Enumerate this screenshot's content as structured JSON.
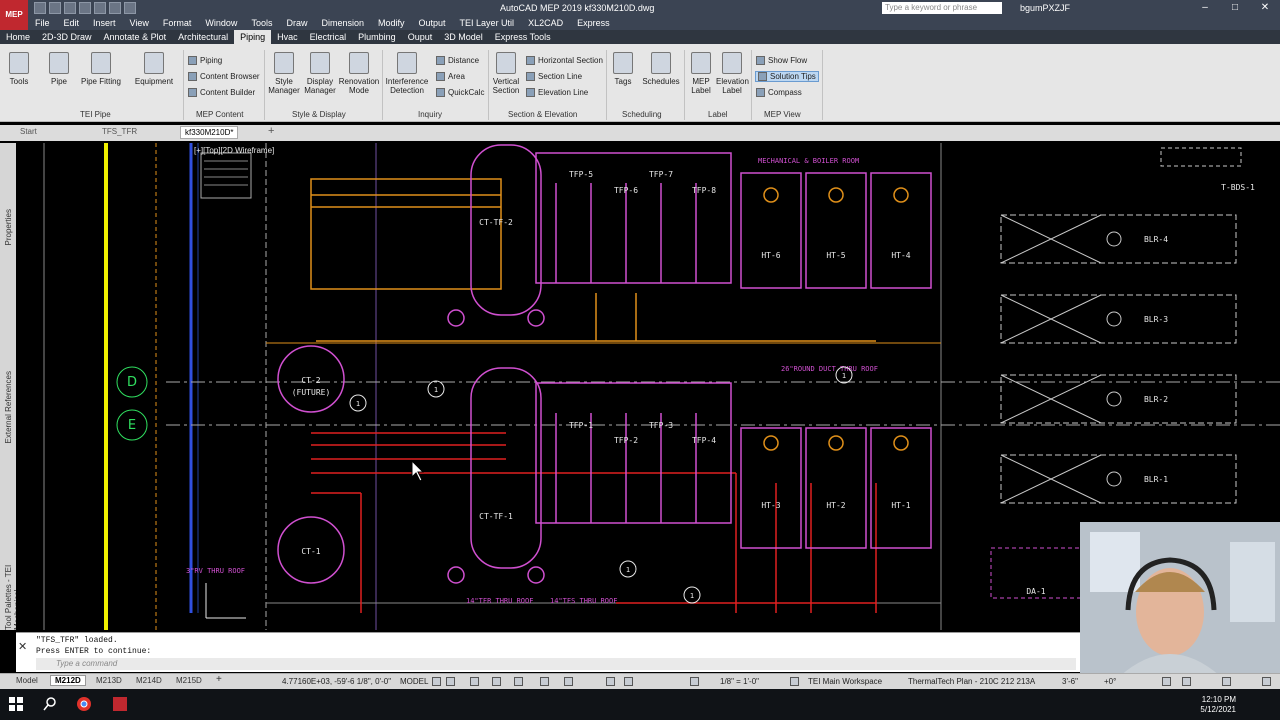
{
  "app": {
    "title": "AutoCAD MEP 2019    kf330M210D.dwg",
    "logo": "MEP",
    "search_placeholder": "Type a keyword or phrase",
    "user": "bgumPXZJF"
  },
  "menu": [
    "File",
    "Edit",
    "Insert",
    "View",
    "Format",
    "Window",
    "Tools",
    "Draw",
    "Dimension",
    "Modify",
    "Output",
    "TEI Layer Util",
    "XL2CAD",
    "Express"
  ],
  "ribbon_tabs": [
    "Home",
    "2D-3D Draw",
    "Annotate & Plot",
    "Architectural",
    "Piping",
    "Hvac",
    "Electrical",
    "Plumbing",
    "Ouput",
    "3D Model",
    "Express Tools"
  ],
  "ribbon_active_tab": "Piping",
  "ribbon": {
    "tools": "Tools",
    "pipe": "Pipe",
    "pipe_fitting": "Pipe Fitting",
    "equipment": "Equipment",
    "piping": "Piping",
    "content_browser": "Content Browser",
    "content_builder": "Content Builder",
    "style_manager": "Style\nManager",
    "display_manager": "Display\nManager",
    "renovation_mode": "Renovation\nMode",
    "interference_detection": "Interference\nDetection",
    "distance": "Distance",
    "area": "Area",
    "quickcalc": "QuickCalc",
    "vertical_section": "Vertical\nSection",
    "horizontal_section": "Horizontal Section",
    "section_line": "Section Line",
    "elevation_line": "Elevation Line",
    "tags": "Tags",
    "schedules": "Schedules",
    "mep_label": "MEP\nLabel",
    "elevation_label": "Elevation\nLabel",
    "show_flow": "Show Flow",
    "solution_tips": "Solution Tips",
    "compass": "Compass",
    "panels": [
      "TEI Pipe",
      "MEP Content",
      "Style & Display",
      "Inquiry",
      "Section & Elevation",
      "Scheduling",
      "Label",
      "MEP View"
    ]
  },
  "doc_tabs": [
    "Start",
    "TFS_TFR",
    "kf330M210D*"
  ],
  "palettes": [
    "Properties",
    "External References",
    "Tool Palettes - TEI Mechanical"
  ],
  "viewport_label": "[+][Top][2D Wireframe]",
  "drawing": {
    "grid": [
      "D",
      "E"
    ],
    "labels": [
      "CT-2",
      "(FUTURE)",
      "CT-1",
      "CT-TF-2",
      "CT-TF-1",
      "TFP-5",
      "TFP-7",
      "TFP-6",
      "TFP-8",
      "TFP-1",
      "TFP-3",
      "TFP-2",
      "TFP-4",
      "HT-6",
      "HT-5",
      "HT-4",
      "HT-3",
      "HT-2",
      "HT-1",
      "BLR-4",
      "BLR-3",
      "BLR-2",
      "BLR-1",
      "T-BDS-1",
      "DA-1",
      "MECHANICAL & BOILER ROOM",
      "26\"ROUND DUCT THRU ROOF",
      "14\"TFR THRU ROOF",
      "14\"TFS THRU ROOF",
      "3\"RV THRU ROOF",
      "1"
    ]
  },
  "command": {
    "line1": "\"TFS_TFR\" loaded.",
    "line2": "Press ENTER to continue:",
    "placeholder": "Type a command"
  },
  "layout_tabs": [
    "Model",
    "M212D",
    "M213D",
    "M214D",
    "M215D"
  ],
  "status": {
    "coords": "4.77160E+03, -59'-6 1/8\", 0'-0\"",
    "model": "MODEL",
    "scale": "1/8\" = 1'-0\"",
    "workspace": "TEI Main Workspace",
    "plan": "ThermalTech Plan - 210C 212 213A",
    "elev": "3'-6\"",
    "angle": "+0°"
  },
  "clock": {
    "time": "12:10 PM",
    "date": "5/12/2021"
  },
  "colors": {
    "magenta": "#d050d0",
    "orange": "#e0901a",
    "red": "#e02020",
    "yellow": "#f0f000",
    "blue": "#3050e0",
    "white": "#e8e8e8",
    "cyan": "#40e0e0"
  }
}
